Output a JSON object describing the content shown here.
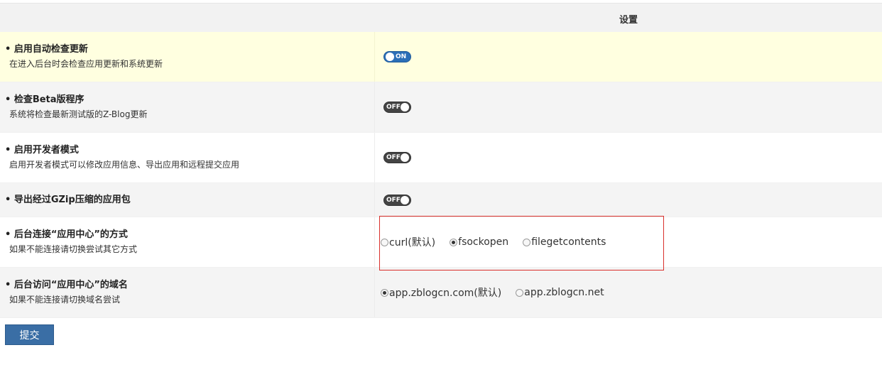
{
  "header": {
    "title": "设置"
  },
  "settings": [
    {
      "title": "• 启用自动检查更新",
      "desc": "在进入后台时会检查应用更新和系统更新",
      "toggle": "ON"
    },
    {
      "title": "• 检查Beta版程序",
      "desc": "系统将检查最新测试版的Z-Blog更新",
      "toggle": "OFF"
    },
    {
      "title": "• 启用开发者模式",
      "desc": "启用开发者模式可以修改应用信息、导出应用和远程提交应用",
      "toggle": "OFF"
    },
    {
      "title": "• 导出经过GZip压缩的应用包",
      "toggle": "OFF"
    },
    {
      "title": "• 后台连接“应用中心”的方式",
      "desc": "如果不能连接请切换尝试其它方式",
      "options": [
        "curl(默认)",
        "fsockopen",
        "filegetcontents"
      ],
      "selected": "fsockopen"
    },
    {
      "title": "• 后台访问“应用中心”的域名",
      "desc": "如果不能连接请切换域名尝试",
      "options": [
        "app.zblogcn.com(默认)",
        "app.zblogcn.net"
      ],
      "selected": "app.zblogcn.com(默认)"
    }
  ],
  "submit_label": "提交",
  "colors": {
    "highlight_border": "#d9302c",
    "toggle_on": "#2c6fb7",
    "toggle_off": "#444444",
    "submit_bg": "#3a6ea5"
  }
}
